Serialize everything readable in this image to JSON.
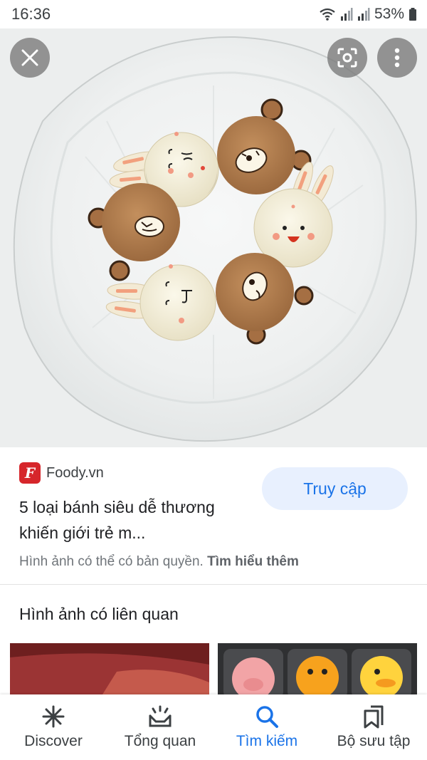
{
  "status_bar": {
    "time": "16:36",
    "battery": "53%",
    "icons": [
      "wifi-icon",
      "signal-icon",
      "signal-icon",
      "battery-icon"
    ]
  },
  "viewer": {
    "buttons": [
      "close-icon",
      "lens-icon",
      "more-vert-icon"
    ]
  },
  "source": {
    "logo_letter": "F",
    "site": "Foody.vn",
    "title": "5 loại bánh siêu dễ thương khiến giới trẻ m...",
    "visit_label": "Truy cập",
    "copyright_text": "Hình ảnh có thể có bản quyền.",
    "learn_more": "Tìm hiểu thêm"
  },
  "related": {
    "heading": "Hình ảnh có liên quan"
  },
  "bottom_nav": {
    "items": [
      {
        "label": "Discover",
        "icon": "discover-icon"
      },
      {
        "label": "Tổng quan",
        "icon": "updates-icon"
      },
      {
        "label": "Tìm kiếm",
        "icon": "search-icon"
      },
      {
        "label": "Bộ sưu tập",
        "icon": "collections-icon"
      }
    ],
    "active_color": "#1a73e8"
  }
}
